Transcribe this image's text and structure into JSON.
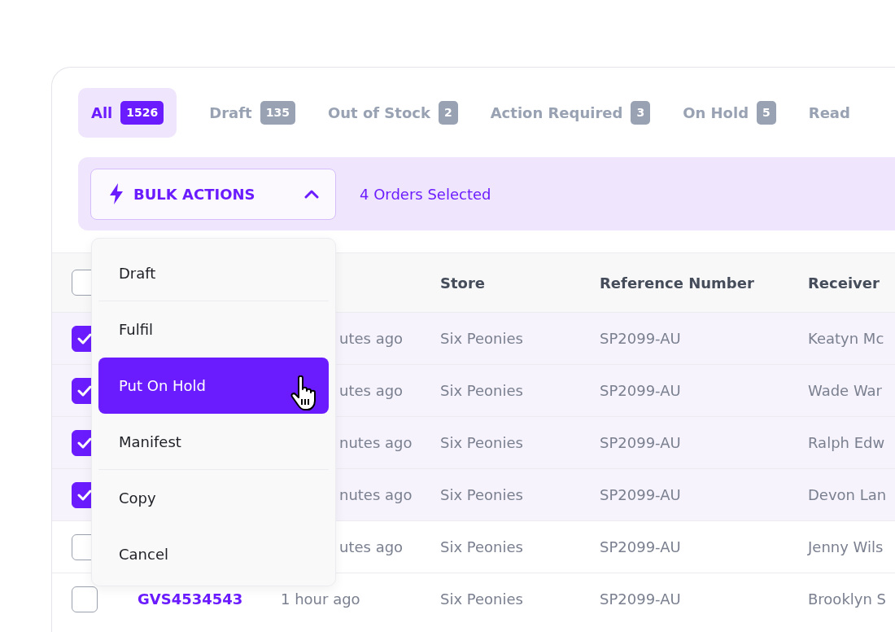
{
  "tabs": [
    {
      "label": "All",
      "count": "1526",
      "selected": true
    },
    {
      "label": "Draft",
      "count": "135",
      "selected": false
    },
    {
      "label": "Out of Stock",
      "count": "2",
      "selected": false
    },
    {
      "label": "Action Required",
      "count": "3",
      "selected": false
    },
    {
      "label": "On Hold",
      "count": "5",
      "selected": false
    },
    {
      "label": "Read",
      "selected": false
    }
  ],
  "bulk_bar": {
    "label": "BULK ACTIONS",
    "expanded": true,
    "selection_text": "4 Orders Selected"
  },
  "menu": {
    "items": [
      {
        "label": "Draft",
        "selected": false,
        "separator_after": true
      },
      {
        "label": "Fulfil",
        "selected": false,
        "separator_after": false
      },
      {
        "label": "Put On Hold",
        "selected": true,
        "separator_after": false
      },
      {
        "label": "Manifest",
        "selected": false,
        "separator_after": true
      },
      {
        "label": "Copy",
        "selected": false,
        "separator_after": false
      },
      {
        "label": "Cancel",
        "selected": false,
        "separator_after": false
      }
    ]
  },
  "table": {
    "header": {
      "checked": false,
      "columns": [
        "Store",
        "Reference Number",
        "Receiver"
      ]
    },
    "rows": [
      {
        "checked": true,
        "under_menu": true,
        "time": "utes ago",
        "store": "Six Peonies",
        "reference": "SP2099-AU",
        "receiver": "Keatyn Mc"
      },
      {
        "checked": true,
        "under_menu": true,
        "time": "utes ago",
        "store": "Six Peonies",
        "reference": "SP2099-AU",
        "receiver": "Wade War"
      },
      {
        "checked": true,
        "under_menu": true,
        "time": "nutes ago",
        "store": "Six Peonies",
        "reference": "SP2099-AU",
        "receiver": "Ralph Edw"
      },
      {
        "checked": true,
        "under_menu": true,
        "time": "nutes ago",
        "store": "Six Peonies",
        "reference": "SP2099-AU",
        "receiver": "Devon Lan"
      },
      {
        "checked": false,
        "under_menu": true,
        "time": "utes ago",
        "store": "Six Peonies",
        "reference": "SP2099-AU",
        "receiver": "Jenny Wils"
      },
      {
        "checked": false,
        "under_menu": false,
        "order": "GVS4534543",
        "time": "1 hour ago",
        "store": "Six Peonies",
        "reference": "SP2099-AU",
        "receiver": "Brooklyn S"
      }
    ]
  }
}
